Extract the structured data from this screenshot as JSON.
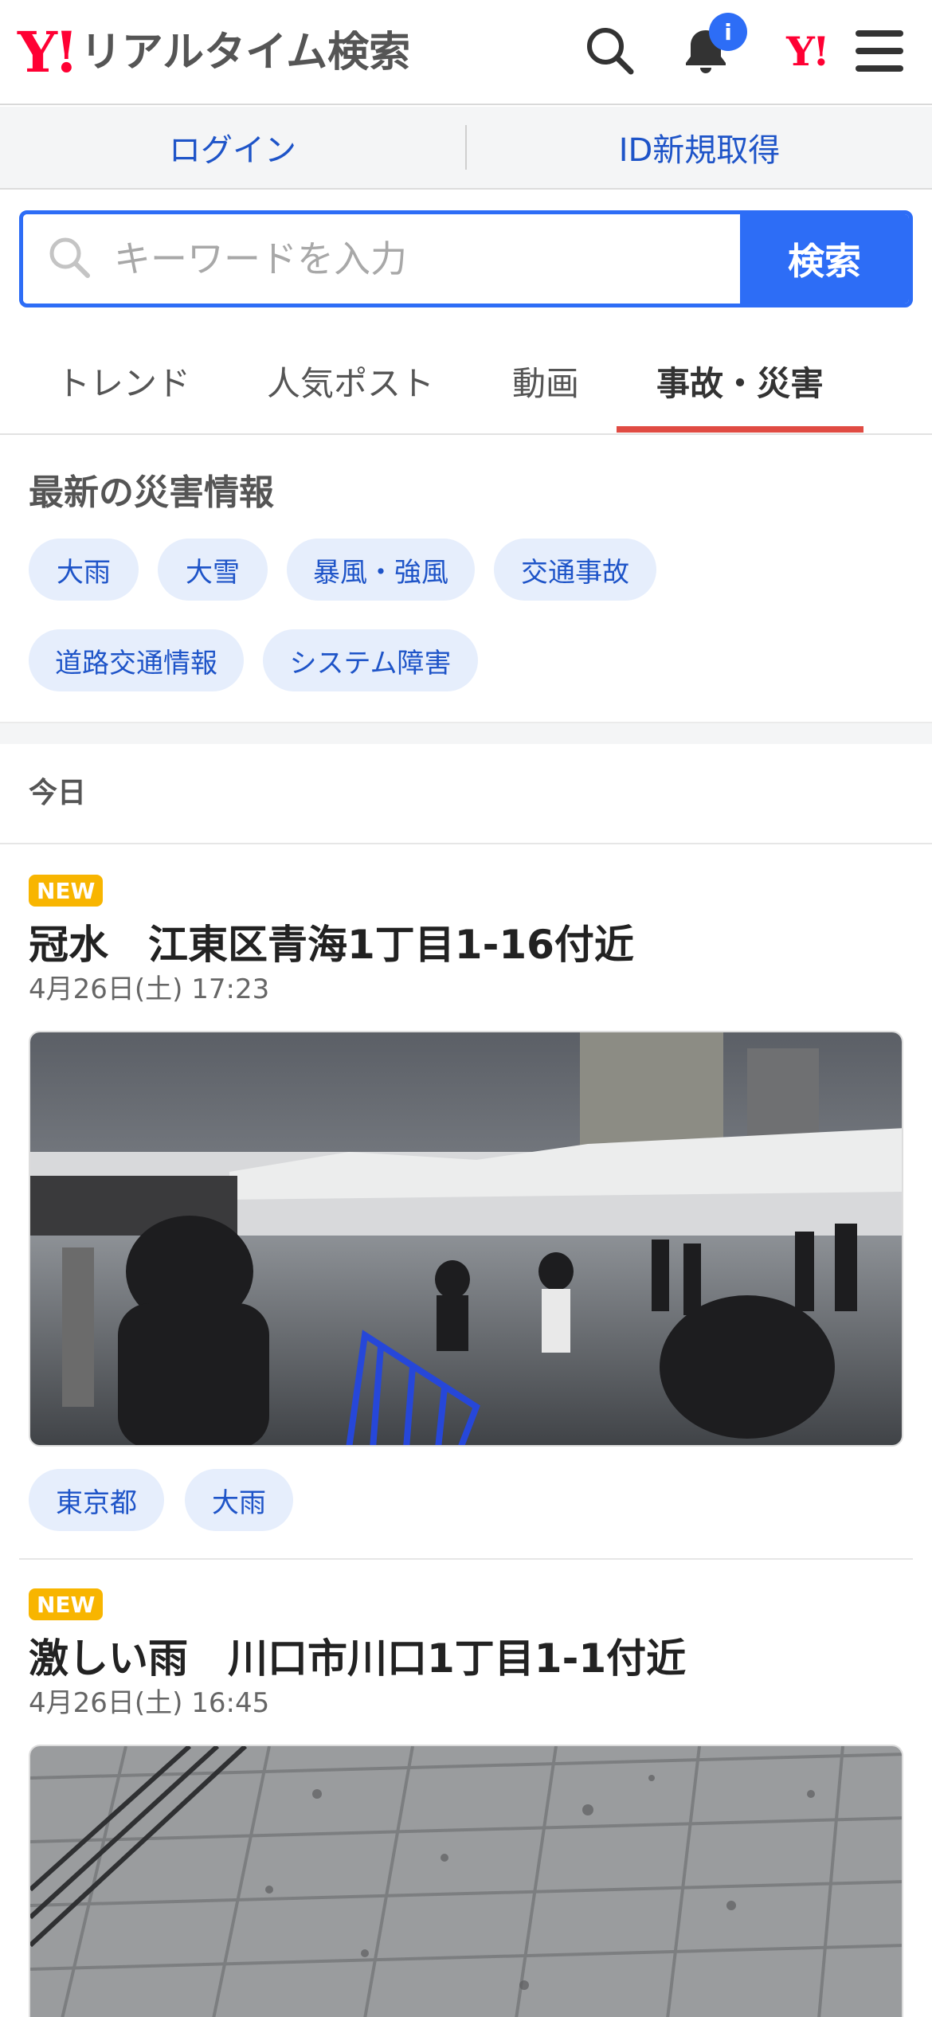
{
  "header": {
    "logo_mark": "Y!",
    "logo_text": "リアルタイム検索",
    "notification_badge": "i",
    "yahoo_mark": "Y!"
  },
  "loginbar": {
    "login": "ログイン",
    "register": "ID新規取得"
  },
  "search": {
    "placeholder": "キーワードを入力",
    "button": "検索"
  },
  "tabs": [
    {
      "label": "トレンド",
      "active": false
    },
    {
      "label": "人気ポスト",
      "active": false
    },
    {
      "label": "動画",
      "active": false
    },
    {
      "label": "事故・災害",
      "active": true
    }
  ],
  "disaster": {
    "title": "最新の災害情報",
    "chips": [
      "大雨",
      "大雪",
      "暴風・強風",
      "交通事故",
      "道路交通情報",
      "システム障害"
    ]
  },
  "feed": {
    "section_label": "今日",
    "posts": [
      {
        "badge": "NEW",
        "title": "冠水　江東区青海1丁目1-16付近",
        "time": "4月26日(土) 17:23",
        "tags": [
          "東京都",
          "大雨"
        ]
      },
      {
        "badge": "NEW",
        "title": "激しい雨　川口市川口1丁目1-1付近",
        "time": "4月26日(土) 16:45",
        "tags": []
      }
    ]
  },
  "colors": {
    "brand_red": "#ff0033",
    "accent_blue": "#2d6df6",
    "tab_underline": "#e04b43",
    "new_badge": "#f8b500"
  }
}
